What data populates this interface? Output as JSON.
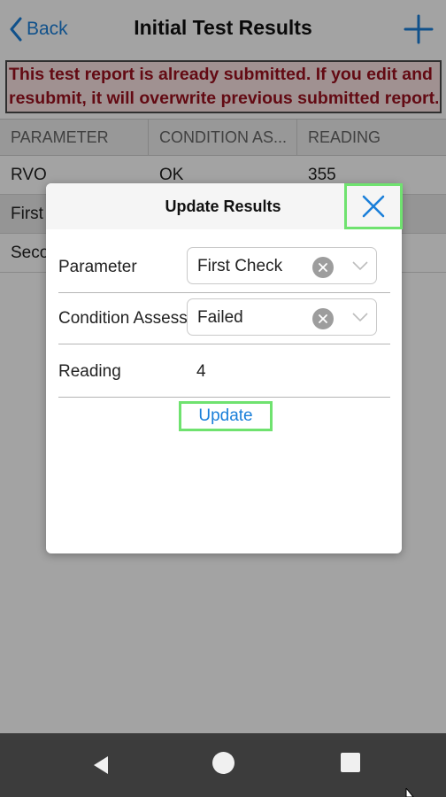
{
  "header": {
    "back_label": "Back",
    "title": "Initial Test Results"
  },
  "warning": {
    "line1": "This test report is already submitted. If you edit and",
    "line2": "resubmit, it will overwrite previous submitted report."
  },
  "table": {
    "columns": [
      "PARAMETER",
      "CONDITION AS...",
      "READING"
    ],
    "rows": [
      [
        "RVO",
        "OK",
        "355"
      ],
      [
        "First",
        "",
        ""
      ],
      [
        "Seco",
        "",
        ""
      ]
    ]
  },
  "dialog": {
    "title": "Update Results",
    "parameter": {
      "label": "Parameter",
      "value": "First Check"
    },
    "condition": {
      "label": "Condition Assess",
      "value": "Failed"
    },
    "reading": {
      "label": "Reading",
      "value": "4"
    },
    "update_label": "Update"
  },
  "colors": {
    "accent": "#1a7fd9",
    "highlight": "#6fe26f",
    "warning_text": "#9b111e",
    "warning_bg": "#fbe3e3"
  }
}
